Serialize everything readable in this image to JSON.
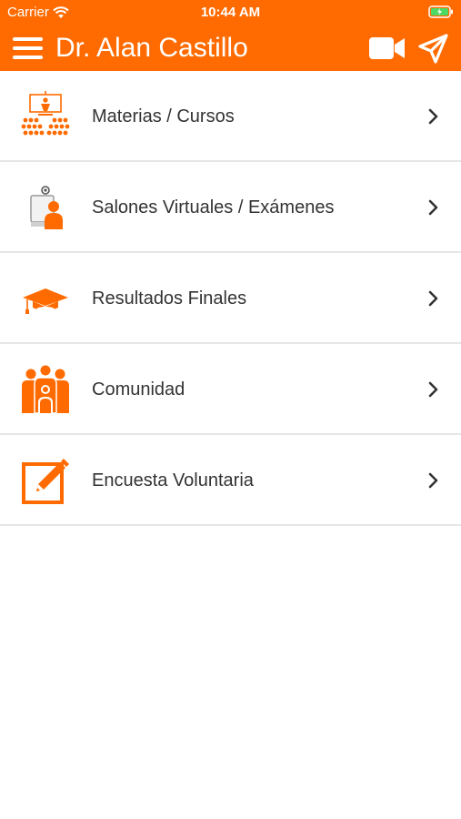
{
  "status_bar": {
    "carrier": "Carrier",
    "time": "10:44 AM"
  },
  "header": {
    "title": "Dr. Alan Castillo"
  },
  "menu": {
    "items": [
      {
        "label": "Materias / Cursos",
        "icon": "classroom-icon"
      },
      {
        "label": "Salones Virtuales / Exámenes",
        "icon": "virtual-classroom-icon"
      },
      {
        "label": "Resultados Finales",
        "icon": "graduation-cap-icon"
      },
      {
        "label": "Comunidad",
        "icon": "community-icon"
      },
      {
        "label": "Encuesta Voluntaria",
        "icon": "edit-survey-icon"
      }
    ]
  },
  "colors": {
    "accent": "#ff6b00",
    "text": "#333333",
    "divider": "#e6e6e6"
  }
}
